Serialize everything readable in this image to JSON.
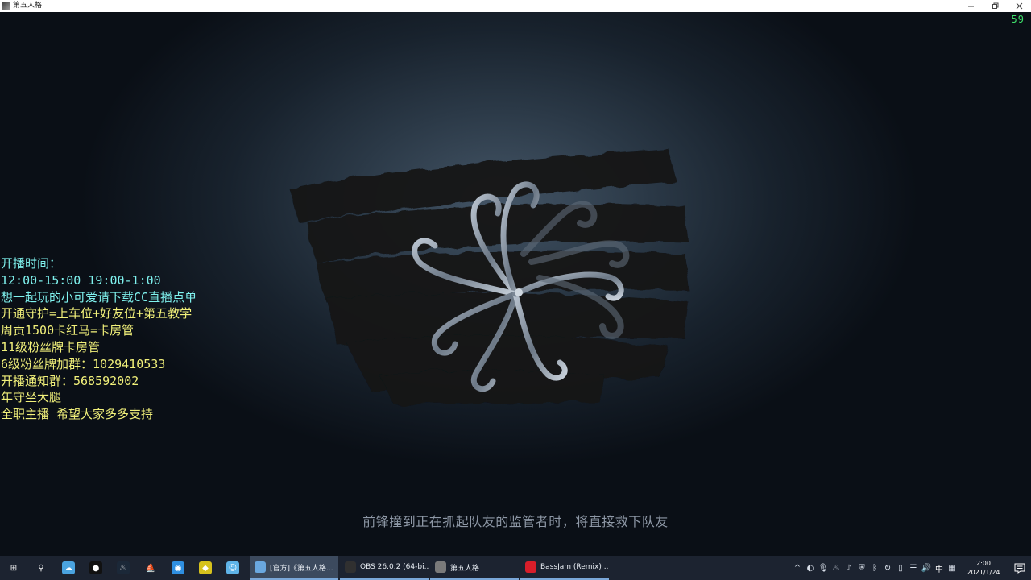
{
  "window": {
    "title": "第五人格",
    "icon": "app-icon",
    "controls": [
      "minimize-icon",
      "restore-icon",
      "close-icon"
    ]
  },
  "overlay": {
    "fps": "59",
    "info_lines": [
      {
        "text": "开播时间：",
        "color": "#7ff2ee"
      },
      {
        "text": "12:00-15:00 19:00-1:00",
        "color": "#7ff2ee"
      },
      {
        "text": "想一起玩的小可爱请下载CC直播点单",
        "color": "#7ff2ee"
      },
      {
        "text": "开通守护=上车位+好友位+第五教学",
        "color": "#f1f07a"
      },
      {
        "text": "周贡1500卡红马=卡房管",
        "color": "#f1f07a"
      },
      {
        "text": "11级粉丝牌卡房管",
        "color": "#f1f07a"
      },
      {
        "text": "6级粉丝牌加群：1029410533",
        "color": "#f1f07a"
      },
      {
        "text": "开播通知群：568592002",
        "color": "#f1f07a"
      },
      {
        "text": "年守坐大腿",
        "color": "#f1f07a"
      },
      {
        "text": "全职主播 希望大家多多支持",
        "color": "#f1f07a"
      }
    ],
    "subtitle": "前锋撞到正在抓起队友的监管者时，将直接救下队友"
  },
  "taskbar": {
    "pinned": [
      {
        "name": "start-icon",
        "glyph": "⊞",
        "color": "#1c2330"
      },
      {
        "name": "search-icon",
        "glyph": "⚲",
        "color": "#1c2330"
      },
      {
        "name": "weather-app-icon",
        "glyph": "☁",
        "color": "#4aa3df"
      },
      {
        "name": "qq-icon",
        "glyph": "●",
        "color": "#111111"
      },
      {
        "name": "steam-icon",
        "glyph": "♨",
        "color": "#1b2838"
      },
      {
        "name": "boat-app-icon",
        "glyph": "⛵",
        "color": "#1c2330"
      },
      {
        "name": "chrome-icon",
        "glyph": "◉",
        "color": "#2f8fe0"
      },
      {
        "name": "green-app-icon",
        "glyph": "◆",
        "color": "#d6c21d"
      },
      {
        "name": "assistant-icon",
        "glyph": "☺",
        "color": "#5fb4e8"
      }
    ],
    "tasks": [
      {
        "name": "task-game-launcher",
        "label": "[官方]《第五人格...",
        "icon_color": "#6aa8e0",
        "active": true
      },
      {
        "name": "task-obs",
        "label": "OBS 26.0.2 (64-bi...",
        "icon_color": "#303030",
        "active": false
      },
      {
        "name": "task-game-window",
        "label": "第五人格",
        "icon_color": "#7a7a7a",
        "active": false
      },
      {
        "name": "task-music-player",
        "label": "BassJam (Remix) ...",
        "icon_color": "#d81e2a",
        "active": false
      }
    ],
    "tray": [
      {
        "name": "tray-chevron-up-icon",
        "glyph": "^"
      },
      {
        "name": "tray-network-app-icon",
        "glyph": "◐"
      },
      {
        "name": "tray-microphone-icon",
        "glyph": "🎙"
      },
      {
        "name": "tray-steam-icon",
        "glyph": "♨"
      },
      {
        "name": "tray-music-icon",
        "glyph": "♪"
      },
      {
        "name": "tray-shield-icon",
        "glyph": "⛨"
      },
      {
        "name": "tray-bluetooth-icon",
        "glyph": "ᛒ"
      },
      {
        "name": "tray-update-icon",
        "glyph": "↻"
      },
      {
        "name": "tray-battery-icon",
        "glyph": "▯"
      },
      {
        "name": "tray-wifi-icon",
        "glyph": "☰"
      },
      {
        "name": "tray-volume-icon",
        "glyph": "🔊"
      }
    ],
    "ime": "中",
    "ime_mode_icon": "▦",
    "clock_time": "2:00",
    "clock_date": "2021/1/24"
  }
}
